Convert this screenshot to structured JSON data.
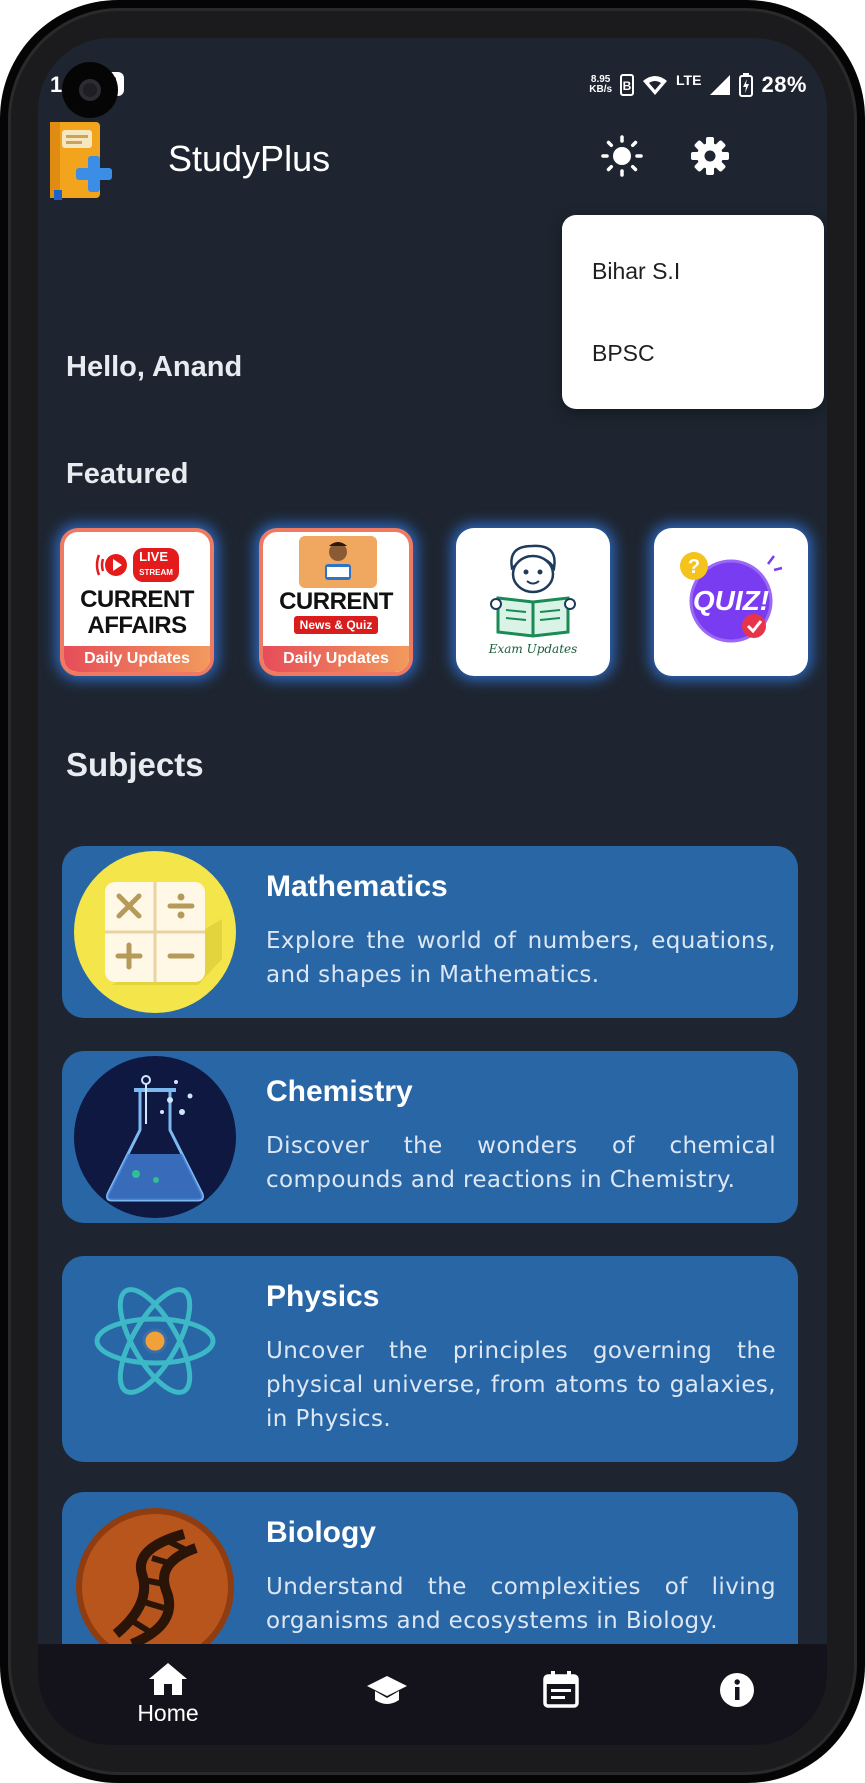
{
  "status_bar": {
    "time": "1",
    "speed_value": "8.95",
    "speed_unit": "KB/s",
    "network": "LTE",
    "battery": "28%"
  },
  "app": {
    "title": "StudyPlus",
    "icons": [
      "book-logo-icon",
      "sun-icon",
      "gear-icon"
    ]
  },
  "popup_menu": {
    "items": [
      "Bihar S.I",
      "BPSC"
    ]
  },
  "greeting": "Hello, Anand",
  "featured": {
    "title": "Featured",
    "cards": [
      {
        "badge": "LIVE",
        "badge_sub": "STREAM",
        "line1": "CURRENT",
        "line2": "AFFAIRS",
        "footer": "Daily Updates"
      },
      {
        "line1": "CURRENT",
        "badge": "News & Quiz",
        "footer": "Daily Updates"
      },
      {
        "label": "Exam Updates"
      },
      {
        "label": "QUIZ!"
      }
    ]
  },
  "subjects": {
    "title": "Subjects",
    "items": [
      {
        "name": "Mathematics",
        "description": "Explore the world of numbers, equations, and shapes in Mathematics.",
        "icon": "math-operators-icon"
      },
      {
        "name": "Chemistry",
        "description": "Discover the wonders of chemical compounds and reactions in Chemistry.",
        "icon": "flask-icon"
      },
      {
        "name": "Physics",
        "description": "Uncover the principles governing the physical universe, from atoms to galaxies, in Physics.",
        "icon": "atom-icon"
      },
      {
        "name": "Biology",
        "description": "Understand the complexities of living organisms and ecosystems in Biology.",
        "icon": "dna-icon"
      }
    ]
  },
  "bottom_nav": {
    "items": [
      {
        "label": "Home",
        "icon": "home-icon",
        "active": true
      },
      {
        "label": "",
        "icon": "graduation-cap-icon"
      },
      {
        "label": "",
        "icon": "calendar-icon"
      },
      {
        "label": "",
        "icon": "info-icon"
      }
    ]
  },
  "colors": {
    "background": "#1e2530",
    "card": "#2866a6",
    "glow": "#3482f5",
    "nav": "#14121a"
  }
}
